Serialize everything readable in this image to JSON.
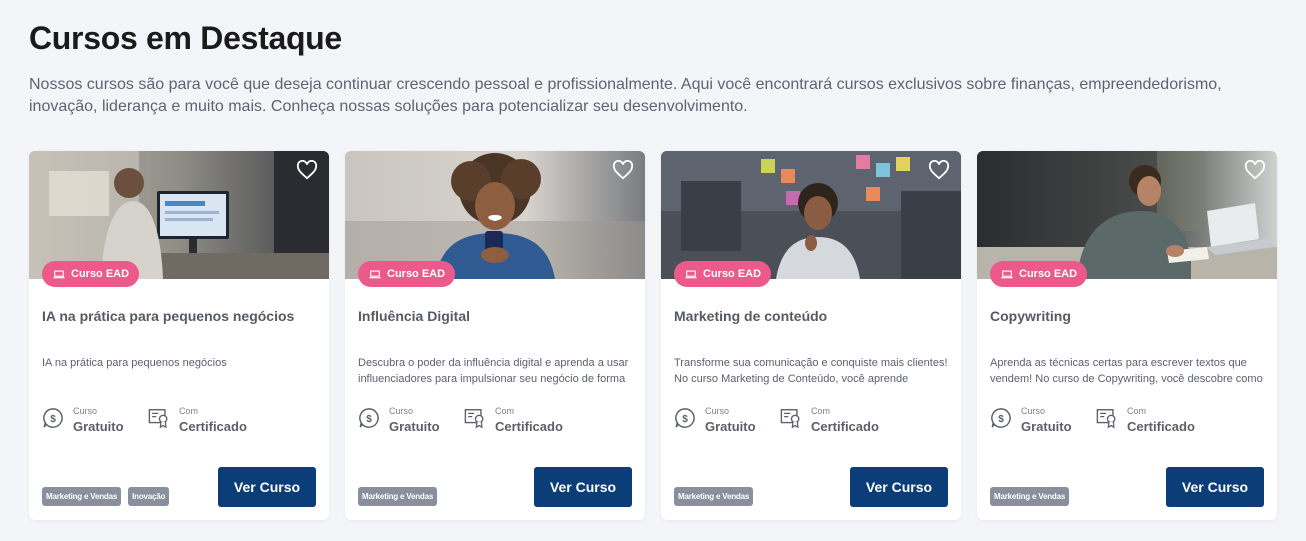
{
  "section": {
    "title": "Cursos em Destaque",
    "description": "Nossos cursos são para você que deseja continuar crescendo pessoal e profissionalmente. Aqui você encontrará cursos exclusivos sobre finanças, empreendedorismo, inovação, liderança e muito mais. Conheça nossas soluções para potencializar seu desenvolvimento."
  },
  "colors": {
    "background": "#f4f5f9",
    "badge": "#ec5a8b",
    "button": "#0b3d79",
    "tag": "#8a8f9d"
  },
  "cards": [
    {
      "image": "man-at-desktop-computer-photo",
      "badge": "Curso EAD",
      "title": "IA na prática para pequenos negócios",
      "description": "IA na prática para pequenos negócios",
      "price_label": "Curso",
      "price_value": "Gratuito",
      "cert_label": "Com",
      "cert_value": "Certificado",
      "tags": [
        "Marketing e Vendas",
        "Inovação"
      ],
      "button": "Ver Curso"
    },
    {
      "image": "smiling-woman-with-phone-photo",
      "badge": "Curso EAD",
      "title": "Influência Digital",
      "description": "Descubra o poder da influência digital e aprenda a usar influenciadores para impulsionar seu negócio de forma",
      "price_label": "Curso",
      "price_value": "Gratuito",
      "cert_label": "Com",
      "cert_value": "Certificado",
      "tags": [
        "Marketing e Vendas"
      ],
      "button": "Ver Curso"
    },
    {
      "image": "woman-thinking-office-photo",
      "badge": "Curso EAD",
      "title": "Marketing de conteúdo",
      "description": "Transforme sua comunicação e conquiste mais clientes! No curso Marketing de Conteúdo, você aprende",
      "price_label": "Curso",
      "price_value": "Gratuito",
      "cert_label": "Com",
      "cert_value": "Certificado",
      "tags": [
        "Marketing e Vendas"
      ],
      "button": "Ver Curso"
    },
    {
      "image": "man-writing-at-laptop-photo",
      "badge": "Curso EAD",
      "title": "Copywriting",
      "description": "Aprenda as técnicas certas para escrever textos que vendem! No curso de Copywriting, você descobre como",
      "price_label": "Curso",
      "price_value": "Gratuito",
      "cert_label": "Com",
      "cert_value": "Certificado",
      "tags": [
        "Marketing e Vendas"
      ],
      "button": "Ver Curso"
    }
  ]
}
